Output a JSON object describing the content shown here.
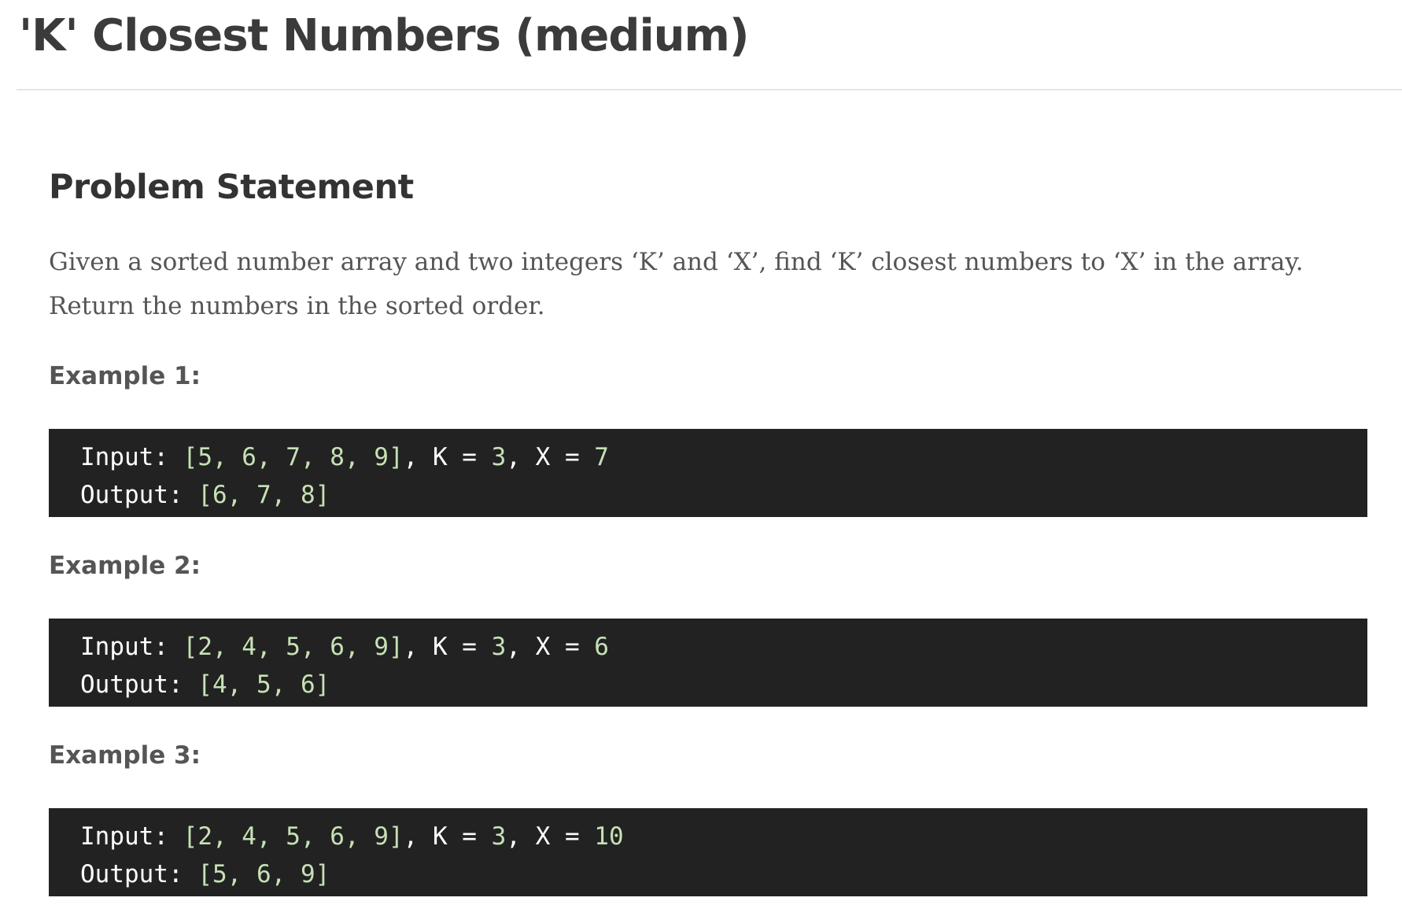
{
  "page": {
    "title": "'K' Closest Numbers (medium)"
  },
  "problem": {
    "heading": "Problem Statement",
    "statement_line1": "Given a sorted number array and two integers ‘K’ and ‘X’, find ‘K’ closest numbers to ‘X’ in the array.",
    "statement_line2": "Return the numbers in the sorted order."
  },
  "examples": [
    {
      "heading": "Example 1:",
      "input_label": "Input:",
      "input_array": "[5, 6, 7, 8, 9]",
      "k_label": "K =",
      "k_value": "3",
      "x_label": "X =",
      "x_value": "7",
      "output_label": "Output:",
      "output_value": "[6, 7, 8]"
    },
    {
      "heading": "Example 2:",
      "input_label": "Input:",
      "input_array": "[2, 4, 5, 6, 9]",
      "k_label": "K =",
      "k_value": "3",
      "x_label": "X =",
      "x_value": "6",
      "output_label": "Output:",
      "output_value": "[4, 5, 6]"
    },
    {
      "heading": "Example 3:",
      "input_label": "Input:",
      "input_array": "[2, 4, 5, 6, 9]",
      "k_label": "K =",
      "k_value": "3",
      "x_label": "X =",
      "x_value": "10",
      "output_label": "Output:",
      "output_value": "[5, 6, 9]"
    }
  ],
  "colors": {
    "title_text": "#3b3b3b",
    "body_text": "#555555",
    "code_background": "#222222",
    "code_text": "#ffffff",
    "code_value": "#c6e1b5",
    "rule": "#e6e6e6"
  }
}
